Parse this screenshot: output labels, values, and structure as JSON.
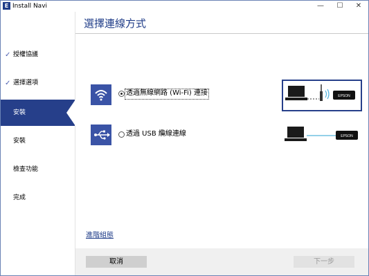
{
  "window": {
    "app_icon_letter": "E",
    "title": "Install Navi",
    "minimize_glyph": "—",
    "maximize_glyph": "☐",
    "close_glyph": "✕"
  },
  "sidebar": {
    "items": [
      {
        "label": "授權協議",
        "checked": true,
        "check_glyph": "✓"
      },
      {
        "label": "選擇選項",
        "checked": true,
        "check_glyph": "✓"
      },
      {
        "label": "安裝",
        "active": true
      },
      {
        "label": "安裝"
      },
      {
        "label": "檢查功能"
      },
      {
        "label": "完成"
      }
    ]
  },
  "main": {
    "title": "選擇連線方式",
    "options": [
      {
        "label": "透過無線網路 (Wi-Fi) 連接",
        "selected": true,
        "icon": "wifi-icon"
      },
      {
        "label": "透過 USB 纜線連線",
        "selected": false,
        "icon": "usb-icon"
      }
    ],
    "printer_brand": "EPSON",
    "advanced_link": "進階組態"
  },
  "footer": {
    "cancel_label": "取消",
    "next_label": "下一步"
  },
  "colors": {
    "accent": "#263f8a",
    "icon_bg": "#3a53a6",
    "title_blue": "#1f3c88"
  }
}
